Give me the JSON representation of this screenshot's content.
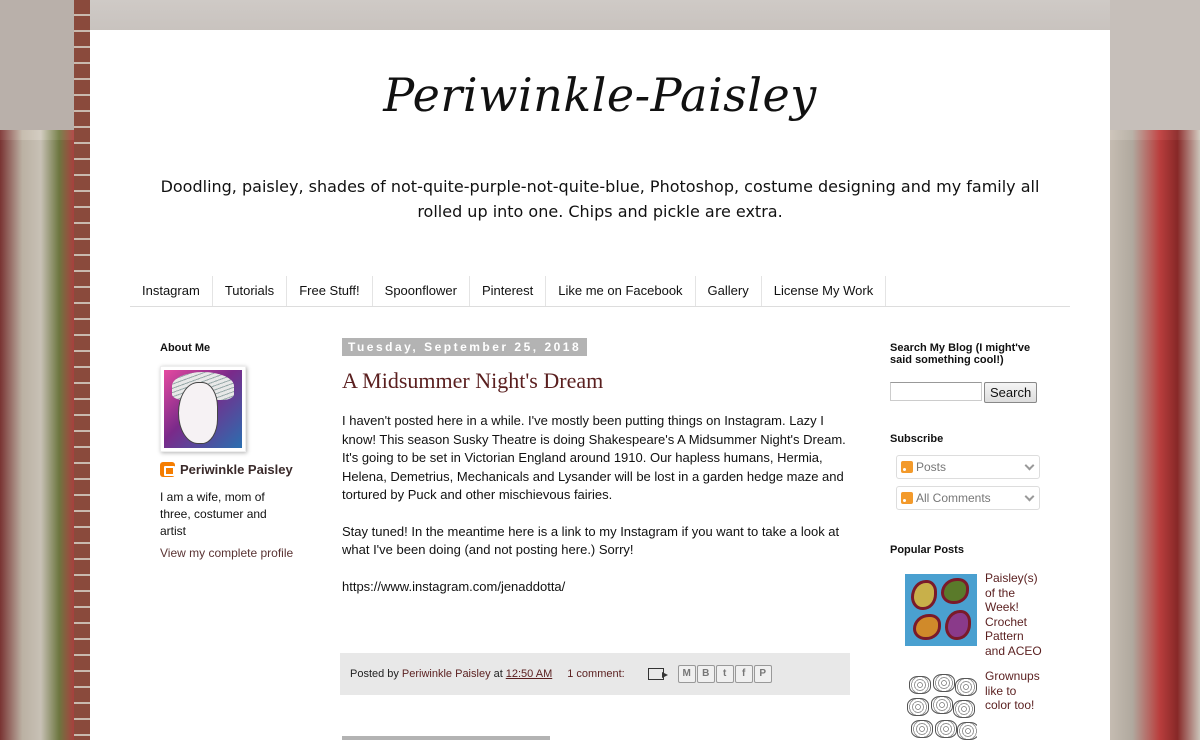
{
  "blog": {
    "title": "Periwinkle-Paisley",
    "description": "Doodling, paisley, shades of not-quite-purple-not-quite-blue, Photoshop, costume designing and my family all rolled up into one. Chips and pickle are extra."
  },
  "tabs": [
    "Instagram",
    "Tutorials",
    "Free Stuff!",
    "Spoonflower",
    "Pinterest",
    "Like me on Facebook",
    "Gallery",
    "License My Work"
  ],
  "about": {
    "title": "About Me",
    "name": "Periwinkle Paisley",
    "bio": "I am a wife, mom of three, costumer and artist",
    "profile_link": "View my complete profile"
  },
  "post": {
    "date": "Tuesday, September 25, 2018",
    "title": "A Midsummer Night's Dream",
    "paragraphs": [
      "I haven't posted here in a while.  I've mostly been putting things on Instagram. Lazy I know!  This season Susky Theatre is doing Shakespeare's A Midsummer Night's Dream.  It's going to be set in Victorian England around 1910. Our hapless humans, Hermia, Helena, Demetrius, Mechanicals and Lysander will be lost in a garden hedge maze and tortured by Puck and other mischievous fairies.",
      "Stay tuned!  In the meantime here is a link to my Instagram if you want to take a look at what I've been doing (and not posting here.)  Sorry!",
      "https://www.instagram.com/jenaddotta/"
    ],
    "footer": {
      "posted_by": "Posted by",
      "author": "Periwinkle Paisley",
      "at": "at",
      "time": "12:50 AM",
      "comments": "1 comment:"
    },
    "share_buttons": [
      "M",
      "B",
      "t",
      "f",
      "P"
    ]
  },
  "sidebar": {
    "search_title": "Search My Blog (I might've said something cool!)",
    "search_value": "",
    "search_button": "Search",
    "subscribe_title": "Subscribe",
    "subscribe_options": [
      "Posts",
      "All Comments"
    ],
    "popular_title": "Popular Posts",
    "popular_posts": [
      "Paisley(s) of the Week! Crochet Pattern and ACEO",
      "Grownups like to color too!"
    ]
  }
}
